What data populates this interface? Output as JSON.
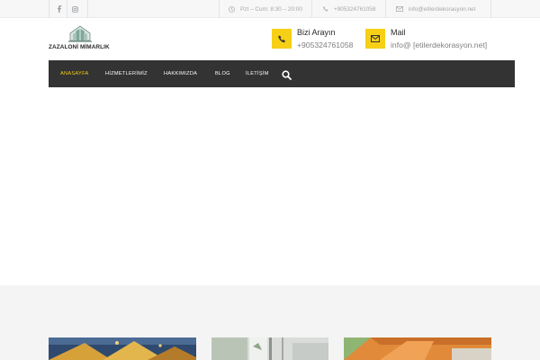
{
  "topbar": {
    "social_icons": [
      "facebook-icon",
      "instagram-icon"
    ],
    "hours": "Pzt – Cum: 8:30 – 20:00",
    "phone": "+905324761058",
    "email": "info@etilerdekorasyon.net"
  },
  "logo": {
    "text": "ZAZALONİ MİMARLIK"
  },
  "header": {
    "call_title": "Bizi Arayın",
    "call_value": "+905324761058",
    "mail_title": "Mail",
    "mail_value": "info@ [etilerdekorasyon.net]"
  },
  "nav": {
    "items": [
      {
        "label": "ANASAYFA",
        "active": true
      },
      {
        "label": "HİZMETLERİMİZ",
        "active": false
      },
      {
        "label": "HAKKIMIZDA",
        "active": false
      },
      {
        "label": "BLOG",
        "active": false
      },
      {
        "label": "İLETİŞİM",
        "active": false
      }
    ],
    "search_icon": "search-icon"
  },
  "colors": {
    "accent": "#f6cf16",
    "nav_bg": "#333333",
    "topbar_bg": "#f7f7f7",
    "section_bg": "#f4f4f4"
  }
}
